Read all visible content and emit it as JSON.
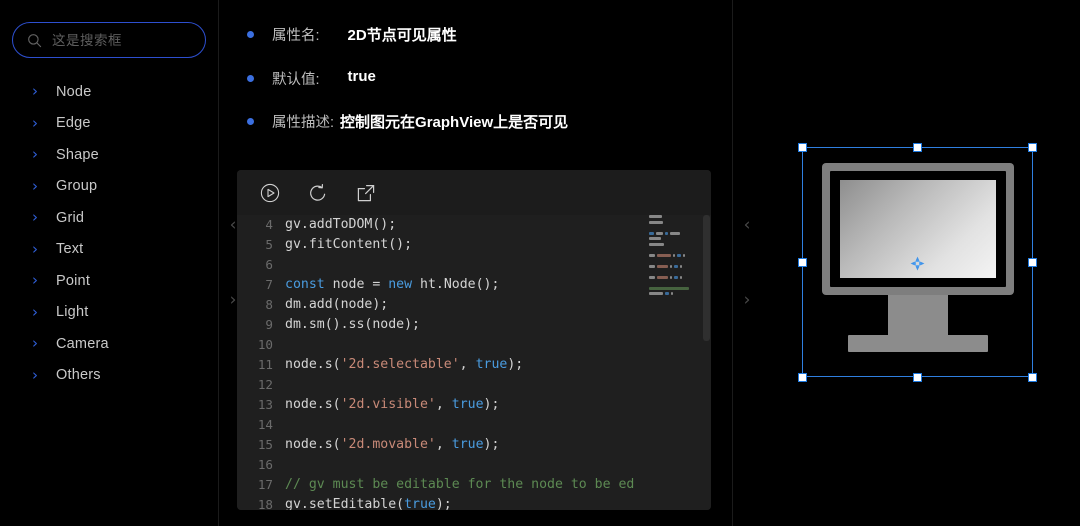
{
  "search": {
    "placeholder": "这是搜索框",
    "value": "",
    "icon": "search-icon"
  },
  "sidebar": {
    "items": [
      {
        "label": "Node",
        "icon": "chevron-right-icon"
      },
      {
        "label": "Edge",
        "icon": "chevron-right-icon"
      },
      {
        "label": "Shape",
        "icon": "chevron-right-icon"
      },
      {
        "label": "Group",
        "icon": "chevron-right-icon"
      },
      {
        "label": "Grid",
        "icon": "chevron-right-icon"
      },
      {
        "label": "Text",
        "icon": "chevron-right-icon"
      },
      {
        "label": "Point",
        "icon": "chevron-right-icon"
      },
      {
        "label": "Light",
        "icon": "chevron-right-icon"
      },
      {
        "label": "Camera",
        "icon": "chevron-right-icon"
      },
      {
        "label": "Others",
        "icon": "chevron-right-icon"
      }
    ]
  },
  "rails": {
    "left": {
      "collapse": "‹",
      "expand": "›"
    },
    "right": {
      "collapse": "‹",
      "expand": "›"
    }
  },
  "properties": [
    {
      "key": "属性名:",
      "value": "2D节点可见属性"
    },
    {
      "key": "默认值:",
      "value": "true"
    },
    {
      "key": "属性描述:",
      "value": "控制图元在GraphView上是否可见"
    }
  ],
  "editor": {
    "toolbar": [
      {
        "name": "run-button",
        "icon": "play-circle-icon",
        "label": "Run"
      },
      {
        "name": "reset-button",
        "icon": "undo-icon",
        "label": "Reset"
      },
      {
        "name": "open-external-button",
        "icon": "external-link-icon",
        "label": "Open"
      }
    ],
    "lines": [
      {
        "no": "4",
        "tokens": [
          {
            "t": "gv.addToDOM();",
            "c": "code-txt"
          }
        ]
      },
      {
        "no": "5",
        "tokens": [
          {
            "t": "gv.fitContent();",
            "c": "code-txt"
          }
        ]
      },
      {
        "no": "6",
        "tokens": [
          {
            "t": "",
            "c": "code-txt"
          }
        ]
      },
      {
        "no": "7",
        "tokens": [
          {
            "t": "const",
            "c": "kw"
          },
          {
            "t": " node = ",
            "c": "code-txt"
          },
          {
            "t": "new",
            "c": "kw"
          },
          {
            "t": " ht.Node();",
            "c": "code-txt"
          }
        ]
      },
      {
        "no": "8",
        "tokens": [
          {
            "t": "dm.add(node);",
            "c": "code-txt"
          }
        ]
      },
      {
        "no": "9",
        "tokens": [
          {
            "t": "dm.sm().ss(node);",
            "c": "code-txt"
          }
        ]
      },
      {
        "no": "10",
        "tokens": [
          {
            "t": "",
            "c": "code-txt"
          }
        ]
      },
      {
        "no": "11",
        "tokens": [
          {
            "t": "node.s(",
            "c": "code-txt"
          },
          {
            "t": "'2d.selectable'",
            "c": "str"
          },
          {
            "t": ", ",
            "c": "code-txt"
          },
          {
            "t": "true",
            "c": "kw"
          },
          {
            "t": ");",
            "c": "code-txt"
          }
        ]
      },
      {
        "no": "12",
        "tokens": [
          {
            "t": "",
            "c": "code-txt"
          }
        ]
      },
      {
        "no": "13",
        "tokens": [
          {
            "t": "node.s(",
            "c": "code-txt"
          },
          {
            "t": "'2d.visible'",
            "c": "str"
          },
          {
            "t": ", ",
            "c": "code-txt"
          },
          {
            "t": "true",
            "c": "kw"
          },
          {
            "t": ");",
            "c": "code-txt"
          }
        ]
      },
      {
        "no": "14",
        "tokens": [
          {
            "t": "",
            "c": "code-txt"
          }
        ]
      },
      {
        "no": "15",
        "tokens": [
          {
            "t": "node.s(",
            "c": "code-txt"
          },
          {
            "t": "'2d.movable'",
            "c": "str"
          },
          {
            "t": ", ",
            "c": "code-txt"
          },
          {
            "t": "true",
            "c": "kw"
          },
          {
            "t": ");",
            "c": "code-txt"
          }
        ]
      },
      {
        "no": "16",
        "tokens": [
          {
            "t": "",
            "c": "code-txt"
          }
        ]
      },
      {
        "no": "17",
        "tokens": [
          {
            "t": "// gv must be editable for the node to be ed",
            "c": "cmt"
          }
        ]
      },
      {
        "no": "18",
        "tokens": [
          {
            "t": "gv.setEditable(",
            "c": "code-txt"
          },
          {
            "t": "true",
            "c": "kw"
          },
          {
            "t": ");",
            "c": "code-txt"
          }
        ]
      }
    ]
  },
  "canvas": {
    "selection": {
      "label": "monitor-node",
      "handle_count": 8,
      "selected": true,
      "accent": "#2f7fe0"
    },
    "anchor": {
      "icon": "anchor-crosshair-icon",
      "color": "#3f93ea"
    }
  },
  "colors": {
    "background": "#000000",
    "accent_blue": "#2f5fd8",
    "bullet": "#3b6fe0",
    "selection": "#2f7fe0",
    "editor_bg": "#1f1f1f",
    "editor_toolbar_bg": "#1c1c1c"
  }
}
